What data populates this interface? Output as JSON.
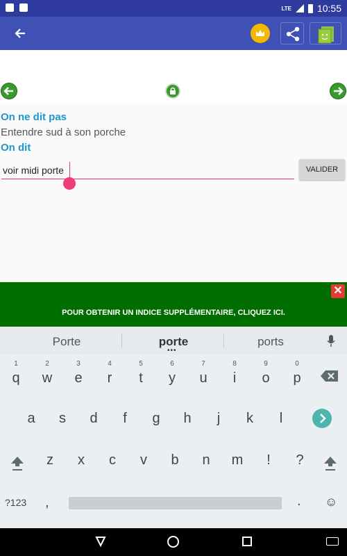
{
  "status_bar": {
    "time": "10:55",
    "network": "LTE"
  },
  "app_bar": {
    "icons": [
      "back-arrow-icon",
      "crown-icon",
      "share-icon",
      "app-icon"
    ],
    "colors": {
      "primary": "#3f51b5",
      "accent": "#f5b800"
    }
  },
  "puzzle": {
    "heading_wrong": "On ne dit pas",
    "wrong_phrase": "Entendre sud à son porche",
    "heading_right": "On dit",
    "answer_value": "voir midi porte",
    "validate_label": "VALIDER"
  },
  "hint": {
    "text": "POUR OBTENIR UN INDICE SUPPLÉMENTAIRE, CLIQUEZ ICI.",
    "close_label": "✕",
    "color": "#006d00"
  },
  "keyboard": {
    "suggestions": [
      "Porte",
      "porte",
      "ports"
    ],
    "row1": [
      {
        "k": "q",
        "n": "1"
      },
      {
        "k": "w",
        "n": "2"
      },
      {
        "k": "e",
        "n": "3"
      },
      {
        "k": "r",
        "n": "4"
      },
      {
        "k": "t",
        "n": "5"
      },
      {
        "k": "y",
        "n": "6"
      },
      {
        "k": "u",
        "n": "7"
      },
      {
        "k": "i",
        "n": "8"
      },
      {
        "k": "o",
        "n": "9"
      },
      {
        "k": "p",
        "n": "0"
      }
    ],
    "row2": [
      "a",
      "s",
      "d",
      "f",
      "g",
      "h",
      "j",
      "k",
      "l"
    ],
    "row3": [
      "z",
      "x",
      "c",
      "v",
      "b",
      "n",
      "m",
      "!",
      "?"
    ],
    "symbols_label": "?123",
    "comma": ",",
    "period": ".",
    "emoji": "☺"
  }
}
